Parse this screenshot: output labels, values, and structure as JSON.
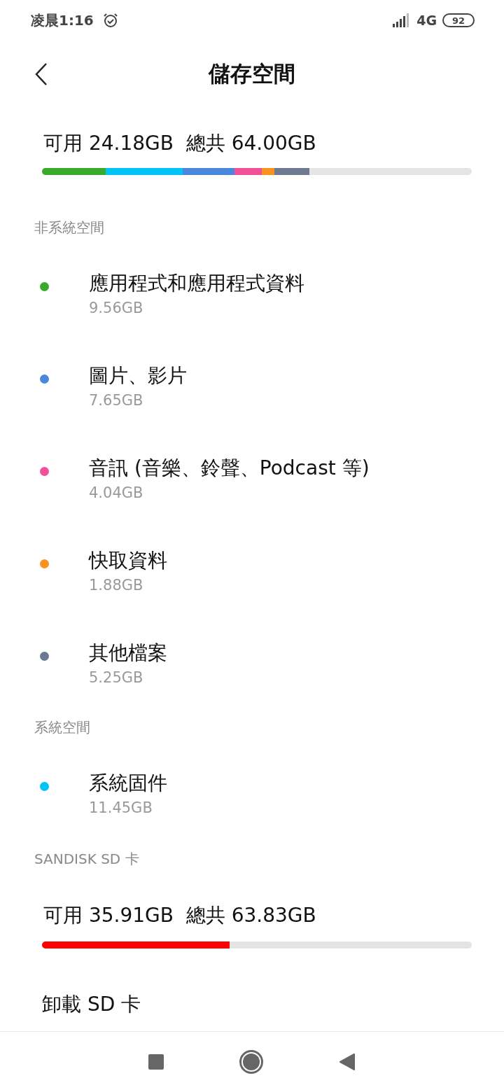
{
  "status_bar": {
    "time": "凌晨1:16",
    "network": "4G",
    "battery": "92"
  },
  "header": {
    "title": "儲存空間"
  },
  "internal": {
    "summary": "可用 24.18GB  總共 64.00GB",
    "segments": [
      {
        "color": "#3aaa2a"
      },
      {
        "color": "#00c3f7"
      },
      {
        "color": "#4a87dc"
      },
      {
        "color": "#f2519a"
      },
      {
        "color": "#f7931e"
      },
      {
        "color": "#6b7a90"
      }
    ]
  },
  "sections": [
    {
      "title": "非系統空間",
      "items": [
        {
          "label": "應用程式和應用程式資料",
          "size": "9.56GB",
          "color": "#3aaa2a"
        },
        {
          "label": "圖片、影片",
          "size": "7.65GB",
          "color": "#4a87dc"
        },
        {
          "label": "音訊 (音樂、鈴聲、Podcast 等)",
          "size": "4.04GB",
          "color": "#f2519a"
        },
        {
          "label": "快取資料",
          "size": "1.88GB",
          "color": "#f7931e"
        },
        {
          "label": "其他檔案",
          "size": "5.25GB",
          "color": "#6b7a90"
        }
      ]
    },
    {
      "title": "系統空間",
      "items": [
        {
          "label": "系統固件",
          "size": "11.45GB",
          "color": "#00c3f7"
        }
      ]
    }
  ],
  "sd_card": {
    "title": "SANDISK SD 卡",
    "summary": "可用 35.91GB  總共 63.83GB",
    "level": 0.437,
    "color": "#ff0000",
    "action": "卸載 SD 卡"
  }
}
